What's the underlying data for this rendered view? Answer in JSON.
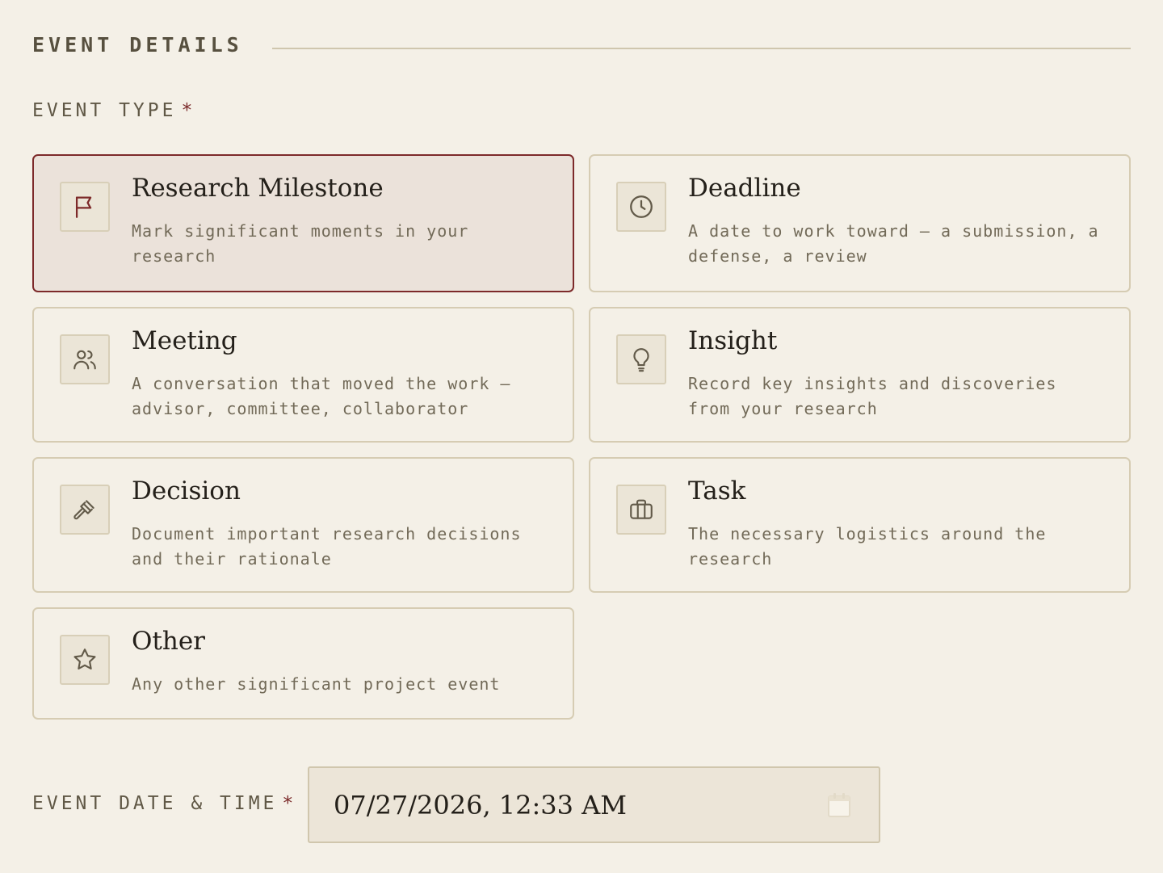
{
  "section": {
    "title": "EVENT DETAILS"
  },
  "event_type": {
    "label": "EVENT TYPE",
    "required_mark": "*",
    "selected": "research-milestone",
    "options": [
      {
        "title": "Research Milestone",
        "description": "Mark significant moments in your research",
        "icon": "flag-icon"
      },
      {
        "title": "Deadline",
        "description": "A date to work toward — a submission, a defense, a review",
        "icon": "clock-icon"
      },
      {
        "title": "Meeting",
        "description": "A conversation that moved the work — advisor, committee, collaborator",
        "icon": "users-icon"
      },
      {
        "title": "Insight",
        "description": "Record key insights and discoveries from your research",
        "icon": "lightbulb-icon"
      },
      {
        "title": "Decision",
        "description": "Document important research decisions and their rationale",
        "icon": "gavel-icon"
      },
      {
        "title": "Task",
        "description": "The necessary logistics around the research",
        "icon": "briefcase-icon"
      },
      {
        "title": "Other",
        "description": "Any other significant project event",
        "icon": "star-icon"
      }
    ]
  },
  "event_date": {
    "label": "EVENT DATE & TIME",
    "required_mark": "*",
    "value": "07/27/2026, 12:33 AM",
    "icon": "calendar-icon"
  },
  "colors": {
    "background": "#f4f0e7",
    "accent": "#7d2a2a",
    "card_border": "#d6ccb3",
    "selected_background": "#ebe2da"
  }
}
